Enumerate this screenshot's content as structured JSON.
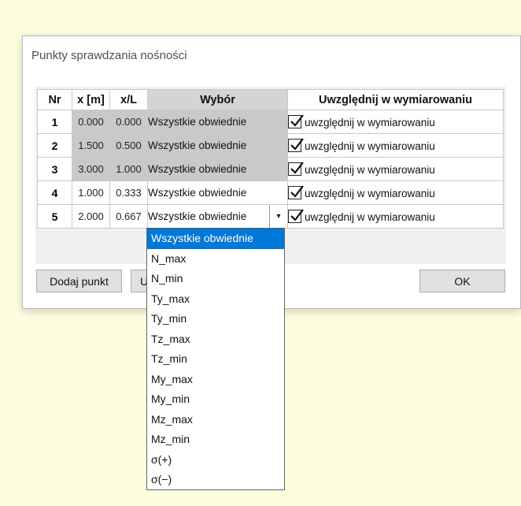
{
  "dialog": {
    "title": "Punkty sprawdzania nośności"
  },
  "table": {
    "headers": {
      "nr": "Nr",
      "x": "x [m]",
      "xl": "x/L",
      "wybor": "Wybór",
      "uwzgl": "Uwzględnij w wymiarowaniu"
    },
    "rows": [
      {
        "nr": "1",
        "x": "0.000",
        "xl": "0.000",
        "wybor": "Wszystkie obwiednie",
        "check_label": "uwzględnij w wymiarowaniu",
        "checked": true
      },
      {
        "nr": "2",
        "x": "1.500",
        "xl": "0.500",
        "wybor": "Wszystkie obwiednie",
        "check_label": "uwzględnij w wymiarowaniu",
        "checked": true
      },
      {
        "nr": "3",
        "x": "3.000",
        "xl": "1.000",
        "wybor": "Wszystkie obwiednie",
        "check_label": "uwzględnij w wymiarowaniu",
        "checked": true
      },
      {
        "nr": "4",
        "x": "1.000",
        "xl": "0.333",
        "wybor": "Wszystkie obwiednie",
        "check_label": "uwzględnij w wymiarowaniu",
        "checked": true
      },
      {
        "nr": "5",
        "x": "2.000",
        "xl": "0.667",
        "wybor": "Wszystkie obwiednie",
        "check_label": "uwzględnij w wymiarowaniu",
        "checked": true
      }
    ]
  },
  "buttons": {
    "add_point": "Dodaj punkt",
    "second_partial": "U",
    "ok": "OK"
  },
  "dropdown": {
    "selected": "Wszystkie obwiednie",
    "options": [
      "Wszystkie obwiednie",
      "N_max",
      "N_min",
      "Ty_max",
      "Ty_min",
      "Tz_max",
      "Tz_min",
      "My_max",
      "My_min",
      "Mz_max",
      "Mz_min",
      "σ(+)",
      "σ(−)"
    ]
  },
  "colors": {
    "background": "#fdfde0",
    "highlight": "#0078d7",
    "gray_cell": "#c9c9c9"
  },
  "icons": {
    "checkbox": "checkbox-checked-icon",
    "dropdown_arrow": "chevron-down-icon"
  }
}
